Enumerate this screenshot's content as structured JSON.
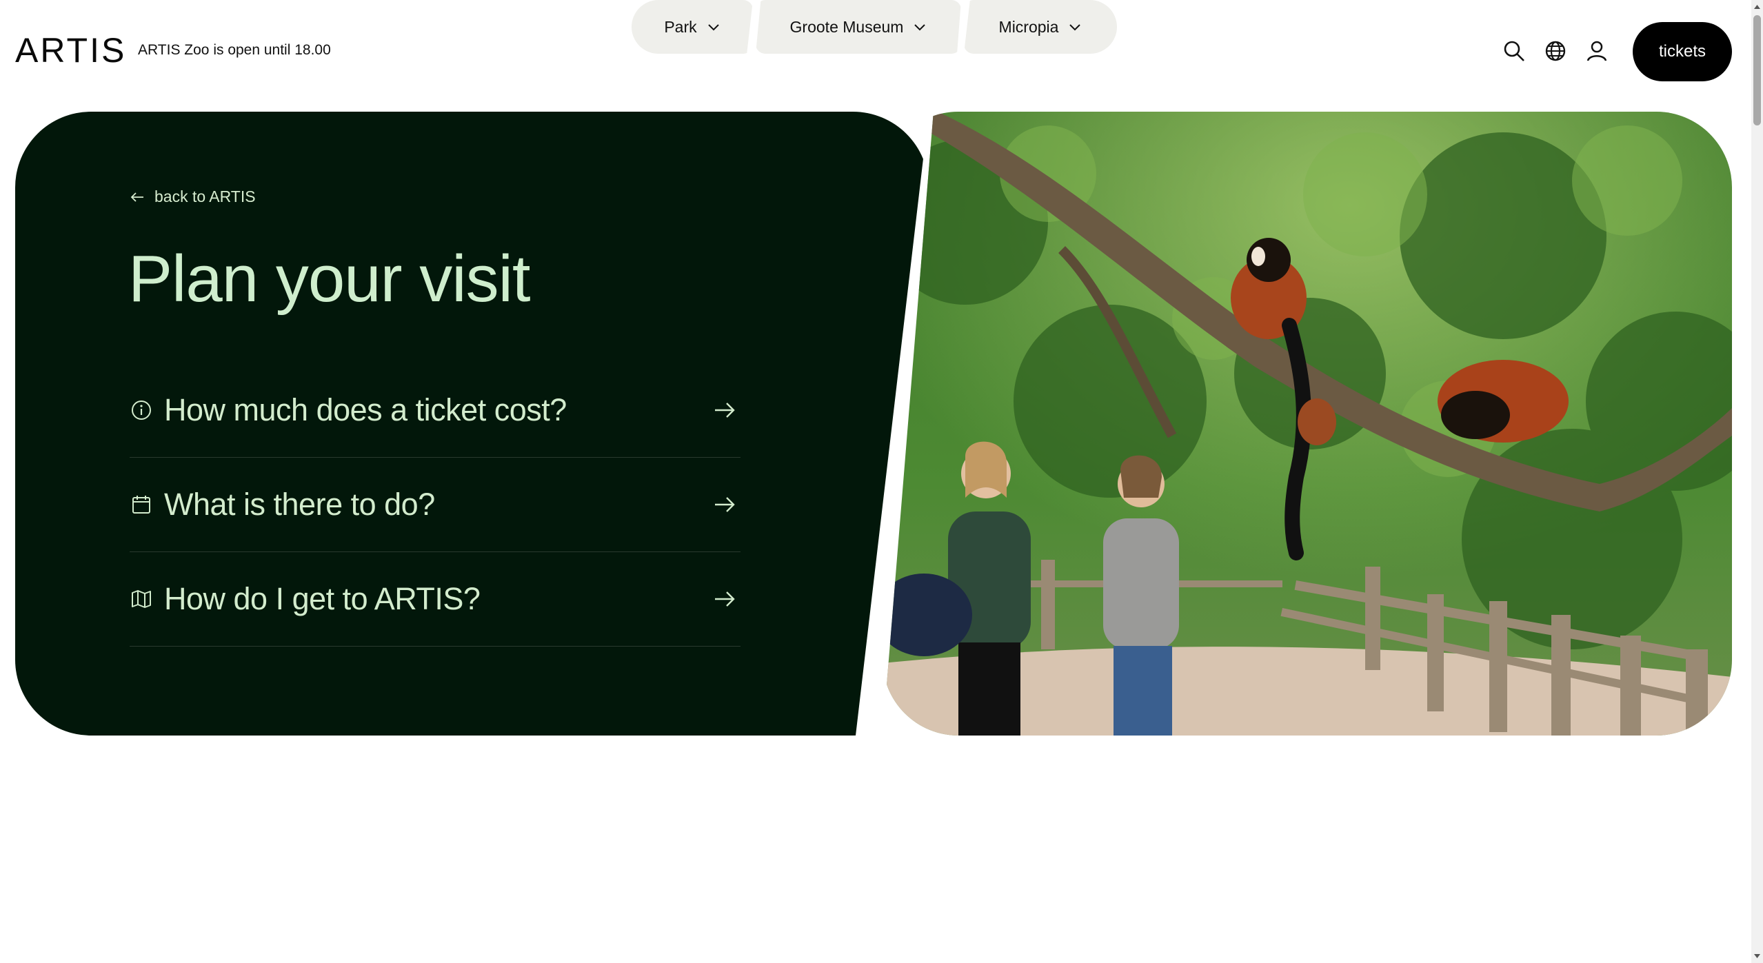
{
  "header": {
    "logo": "ARTIS",
    "status": "ARTIS Zoo is open until 18.00",
    "nav": [
      {
        "label": "Park"
      },
      {
        "label": "Groote Museum"
      },
      {
        "label": "Micropia"
      }
    ],
    "tickets_label": "tickets",
    "icons": [
      "search-icon",
      "globe-icon",
      "user-icon"
    ]
  },
  "hero": {
    "back_label": "back to ARTIS",
    "title": "Plan your visit",
    "faq": [
      {
        "icon": "info-icon",
        "label": "How much does a ticket cost?"
      },
      {
        "icon": "calendar-icon",
        "label": "What is there to do?"
      },
      {
        "icon": "map-icon",
        "label": "How do I get to ARTIS?"
      }
    ]
  },
  "colors": {
    "panel_bg": "#02170a",
    "panel_text": "#cfeecd",
    "pill_bg": "#efefeb",
    "tickets_bg": "#000000"
  }
}
